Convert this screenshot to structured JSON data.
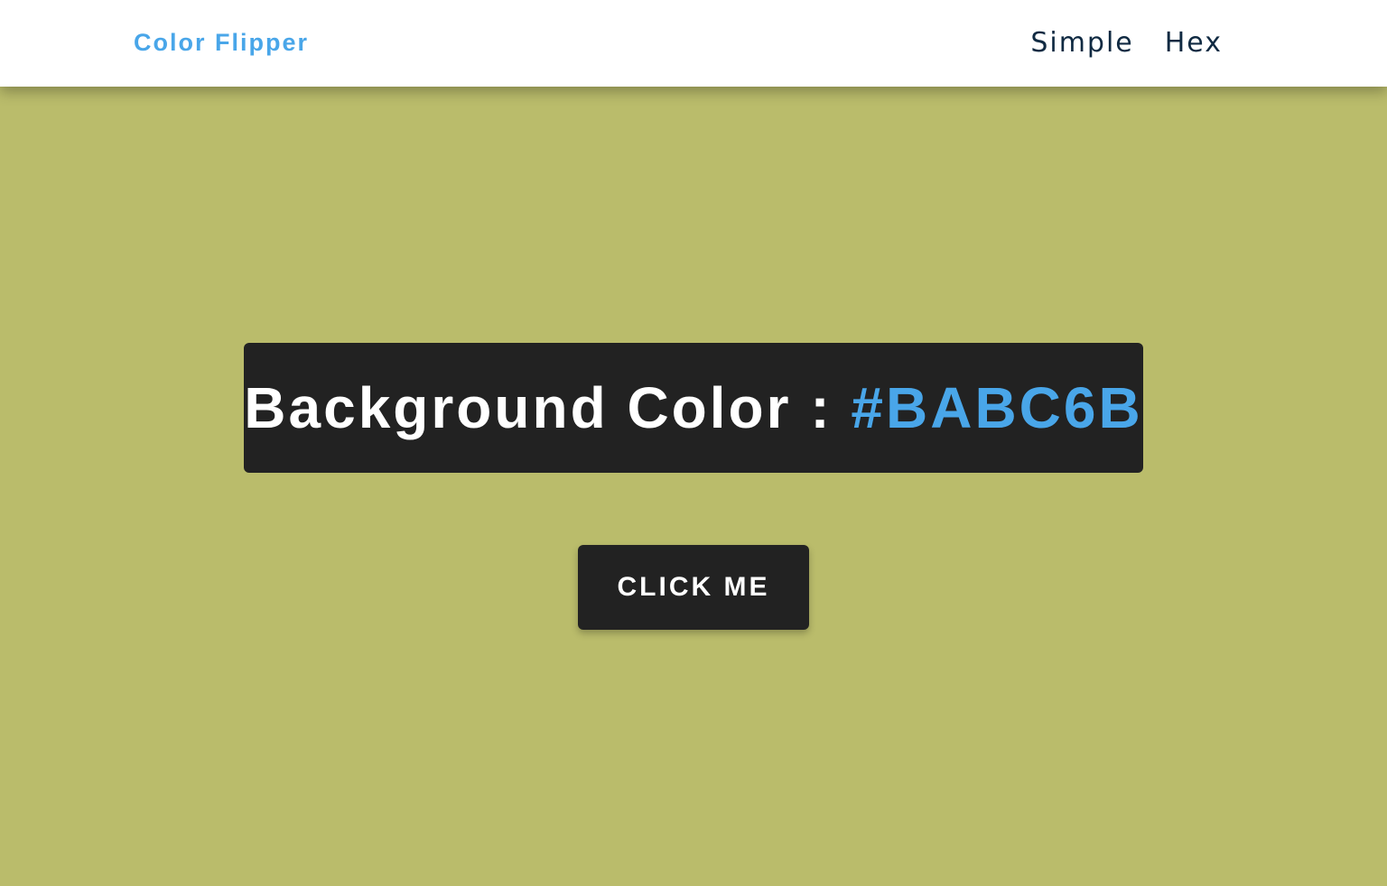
{
  "nav": {
    "brand": "Color Flipper",
    "links": [
      {
        "label": "Simple"
      },
      {
        "label": "Hex"
      }
    ]
  },
  "main": {
    "label": "Background Color :",
    "separator": " ",
    "color_value": "#BABC6B",
    "button_label": "CLICK ME"
  },
  "colors": {
    "page_background": "#babc6b",
    "navbar_background": "#ffffff",
    "brand": "#49a6e9",
    "nav_link": "#102a42",
    "panel_background": "#222222",
    "panel_text": "#ffffff",
    "accent": "#49a6e9"
  }
}
